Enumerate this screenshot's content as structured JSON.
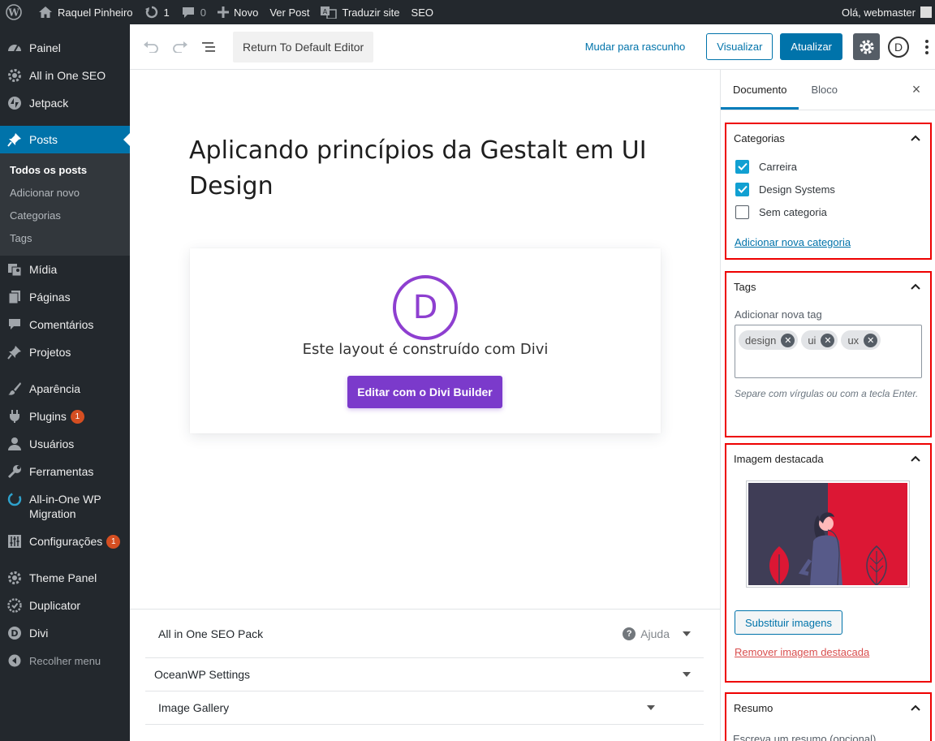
{
  "adminbar": {
    "site_name": "Raquel Pinheiro",
    "updates_count": "1",
    "comments_count": "0",
    "new_label": "Novo",
    "view_post": "Ver Post",
    "translate": "Traduzir site",
    "seo": "SEO",
    "greeting": "Olá, webmaster"
  },
  "menu": {
    "items_top": [
      {
        "label": "Painel",
        "icon": "dashboard-icon"
      },
      {
        "label": "All in One SEO",
        "icon": "gear-icon"
      },
      {
        "label": "Jetpack",
        "icon": "jetpack-icon"
      }
    ],
    "posts": "Posts",
    "posts_sub": [
      "Todos os posts",
      "Adicionar novo",
      "Categorias",
      "Tags"
    ],
    "midia": "Mídia",
    "paginas": "Páginas",
    "comentarios": "Comentários",
    "projetos": "Projetos",
    "aparencia": "Aparência",
    "plugins": "Plugins",
    "plugins_badge": "1",
    "usuarios": "Usuários",
    "ferramentas": "Ferramentas",
    "migration_1": "All-in-One WP",
    "migration_2": "Migration",
    "configuracoes": "Configurações",
    "configuracoes_badge": "1",
    "theme_panel": "Theme Panel",
    "duplicator": "Duplicator",
    "divi": "Divi",
    "collapse": "Recolher menu"
  },
  "toolbar": {
    "default_editor": "Return To Default Editor",
    "draft": "Mudar para rascunho",
    "preview": "Visualizar",
    "update": "Atualizar",
    "divi_letter": "D"
  },
  "post": {
    "title": "Aplicando princípios da Gestalt em UI Design"
  },
  "divi": {
    "logo_letter": "D",
    "message": "Este layout é construído com Divi",
    "button": "Editar com o Divi Builder"
  },
  "metaboxes": {
    "seo": "All in One SEO Pack",
    "help": "Ajuda",
    "help_glyph": "?",
    "oceanwp": "OceanWP Settings",
    "gallery": "Image Gallery"
  },
  "sidebar": {
    "tab_document": "Documento",
    "tab_block": "Bloco",
    "close": "×",
    "categories": {
      "title": "Categorias",
      "items": [
        {
          "label": "Carreira",
          "checked": true
        },
        {
          "label": "Design Systems",
          "checked": true
        },
        {
          "label": "Sem categoria",
          "checked": false
        }
      ],
      "add_link": "Adicionar nova categoria"
    },
    "tags": {
      "title": "Tags",
      "add_label": "Adicionar nova tag",
      "chips": [
        "design",
        "ui",
        "ux"
      ],
      "help": "Separe com vírgulas ou com a tecla Enter."
    },
    "featured": {
      "title": "Imagem destacada",
      "replace": "Substituir imagens",
      "remove": "Remover imagem destacada"
    },
    "excerpt": {
      "title": "Resumo",
      "placeholder": "Escreva um resumo (opcional)"
    }
  },
  "colors": {
    "wp_blue": "#0073aa",
    "divi_purple": "#7b3acb",
    "highlight_red": "#ee0000",
    "image_red": "#dc1734"
  }
}
